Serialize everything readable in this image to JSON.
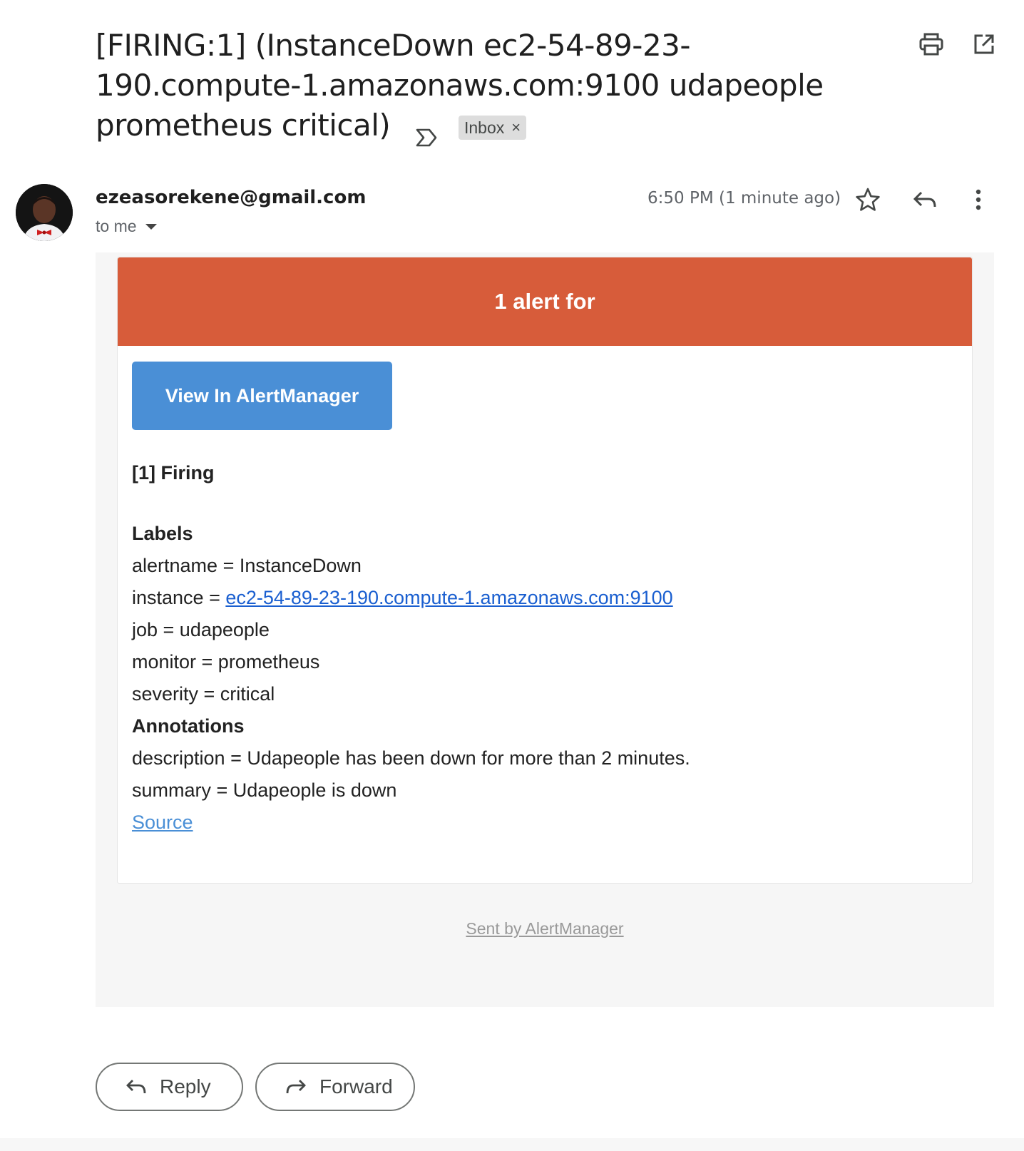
{
  "subject": {
    "title": "[FIRING:1] (InstanceDown ec2-54-89-23-190.compute-1.amazonaws.com:9100 udapeople prometheus critical)",
    "label_chip": "Inbox",
    "label_chip_close": "×"
  },
  "toolbar": {
    "print_icon": "printer-icon",
    "open_new_window_icon": "open-in-new-icon"
  },
  "message": {
    "sender": "ezeasorekene@gmail.com",
    "recipient": "to me",
    "time": "6:50 PM (1 minute ago)"
  },
  "alert": {
    "banner": "1 alert for",
    "button": "View In AlertManager",
    "firing": "[1] Firing",
    "labels_heading": "Labels",
    "alertname": "alertname = InstanceDown",
    "instance_key": "instance = ",
    "instance_value": "ec2-54-89-23-190.compute-1.amazonaws.com:9100",
    "job": "job = udapeople",
    "monitor": "monitor = prometheus",
    "severity": "severity = critical",
    "annotations_heading": "Annotations",
    "description": "description = Udapeople has been down for more than 2 minutes.",
    "summary": "summary = Udapeople is down",
    "source": "Source",
    "footer": "Sent by AlertManager"
  },
  "actions": {
    "reply": "Reply",
    "forward": "Forward"
  },
  "colors": {
    "banner": "#d75c3a",
    "button": "#4a8fd6",
    "link": "#1a5fd0",
    "body_bg": "#f6f6f6"
  }
}
